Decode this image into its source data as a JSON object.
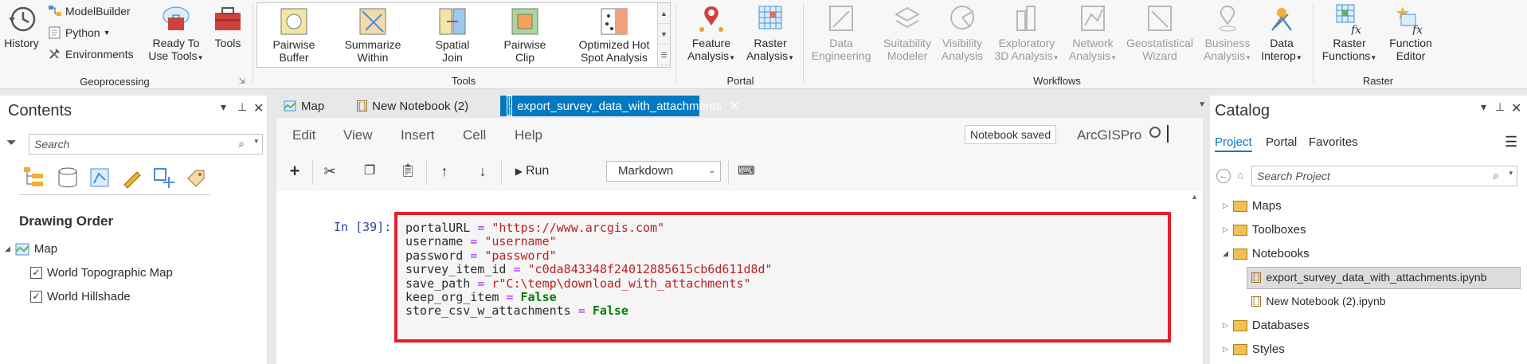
{
  "ribbon": {
    "geoprocessing": {
      "label": "Geoprocessing",
      "history": "History",
      "modelbuilder": "ModelBuilder",
      "python": "Python",
      "environments": "Environments",
      "ready_to_use_1": "Ready To",
      "ready_to_use_2": "Use Tools",
      "tools": "Tools"
    },
    "tools_group": {
      "label": "Tools",
      "items": [
        {
          "l1": "Pairwise",
          "l2": "Buffer"
        },
        {
          "l1": "Summarize",
          "l2": "Within"
        },
        {
          "l1": "Spatial",
          "l2": "Join"
        },
        {
          "l1": "Pairwise",
          "l2": "Clip"
        },
        {
          "l1": "Optimized Hot",
          "l2": "Spot Analysis"
        }
      ]
    },
    "portal": {
      "label": "Portal",
      "feature_1": "Feature",
      "feature_2": "Analysis",
      "raster_1": "Raster",
      "raster_2": "Analysis"
    },
    "workflows": {
      "label": "Workflows",
      "items": [
        {
          "l1": "Data",
          "l2": "Engineering"
        },
        {
          "l1": "Suitability",
          "l2": "Modeler"
        },
        {
          "l1": "Visibility",
          "l2": "Analysis"
        },
        {
          "l1": "Exploratory",
          "l2": "3D Analysis"
        },
        {
          "l1": "Network",
          "l2": "Analysis"
        },
        {
          "l1": "Geostatistical",
          "l2": "Wizard"
        },
        {
          "l1": "Business",
          "l2": "Analysis"
        },
        {
          "l1": "Data",
          "l2": "Interop"
        }
      ]
    },
    "raster": {
      "label": "Raster",
      "rf_1": "Raster",
      "rf_2": "Functions",
      "fe_1": "Function",
      "fe_2": "Editor"
    }
  },
  "contents": {
    "title": "Contents",
    "search_placeholder": "Search",
    "drawing_order": "Drawing Order",
    "map": "Map",
    "layers": [
      "World Topographic Map",
      "World Hillshade"
    ]
  },
  "tabs": [
    "Map",
    "New Notebook (2)",
    "export_survey_data_with_attachments"
  ],
  "notebook": {
    "menu": [
      "Edit",
      "View",
      "Insert",
      "Cell",
      "Help"
    ],
    "status": "Notebook saved",
    "kernel": "ArcGISPro",
    "run": "Run",
    "cell_type": "Markdown",
    "prompt": "In [39]:",
    "code": {
      "l1_var": "portalURL",
      "l1_val": "\"https://www.arcgis.com\"",
      "l2_var": "username",
      "l2_val": "\"username\"",
      "l3_var": "password",
      "l3_val": "\"password\"",
      "l4_var": "survey_item_id",
      "l4_val": "\"c0da843348f24012885615cb6d611d8d\"",
      "l5_var": "save_path",
      "l5_val": "r\"C:\\temp\\download_with_attachments\"",
      "l6_var": "keep_org_item",
      "l6_val": "False",
      "l7_var": "store_csv_w_attachments",
      "l7_val": "False",
      "eq": "="
    }
  },
  "catalog": {
    "title": "Catalog",
    "tabs": [
      "Project",
      "Portal",
      "Favorites"
    ],
    "search_placeholder": "Search Project",
    "items": [
      "Maps",
      "Toolboxes",
      "Notebooks",
      "Databases",
      "Styles"
    ],
    "notebooks": [
      "export_survey_data_with_attachments.ipynb",
      "New Notebook (2).ipynb"
    ]
  }
}
